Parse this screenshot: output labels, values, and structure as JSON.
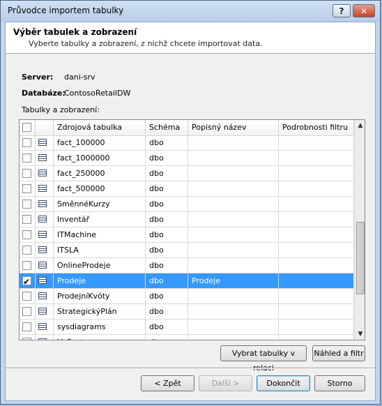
{
  "window": {
    "title": "Průvodce importem tabulky",
    "help_label": "?",
    "close_label": "✕"
  },
  "header": {
    "title": "Výběr tabulek a zobrazení",
    "description": "Vyberte tabulky a zobrazení, z nichž chcete importovat data."
  },
  "info": {
    "server_label": "Server:",
    "server_value": "dani-srv",
    "database_label": "Databáze:",
    "database_value": "ContosoRetailDW"
  },
  "grid": {
    "label": "Tabulky a zobrazení:",
    "columns": [
      "Zdrojová tabulka",
      "Schéma",
      "Popisný název",
      "Podrobnosti filtru"
    ],
    "rows": [
      {
        "checked": false,
        "name": "fact_100000",
        "schema": "dbo",
        "friendly": "",
        "filter": "",
        "selected": false
      },
      {
        "checked": false,
        "name": "fact_1000000",
        "schema": "dbo",
        "friendly": "",
        "filter": "",
        "selected": false
      },
      {
        "checked": false,
        "name": "fact_250000",
        "schema": "dbo",
        "friendly": "",
        "filter": "",
        "selected": false
      },
      {
        "checked": false,
        "name": "fact_500000",
        "schema": "dbo",
        "friendly": "",
        "filter": "",
        "selected": false
      },
      {
        "checked": false,
        "name": "SměnnéKurzy",
        "schema": "dbo",
        "friendly": "",
        "filter": "",
        "selected": false
      },
      {
        "checked": false,
        "name": "Inventář",
        "schema": "dbo",
        "friendly": "",
        "filter": "",
        "selected": false
      },
      {
        "checked": false,
        "name": "ITMachine",
        "schema": "dbo",
        "friendly": "",
        "filter": "",
        "selected": false
      },
      {
        "checked": false,
        "name": "ITSLA",
        "schema": "dbo",
        "friendly": "",
        "filter": "",
        "selected": false
      },
      {
        "checked": false,
        "name": "OnlineProdeje",
        "schema": "dbo",
        "friendly": "",
        "filter": "",
        "selected": false
      },
      {
        "checked": true,
        "name": "Prodeje",
        "schema": "dbo",
        "friendly": "Prodeje",
        "filter": "",
        "selected": true
      },
      {
        "checked": false,
        "name": "ProdejníKvóty",
        "schema": "dbo",
        "friendly": "",
        "filter": "",
        "selected": false
      },
      {
        "checked": false,
        "name": "StrategickýPlán",
        "schema": "dbo",
        "friendly": "",
        "filter": "",
        "selected": false
      },
      {
        "checked": false,
        "name": "sysdiagrams",
        "schema": "dbo",
        "friendly": "",
        "filter": "",
        "selected": false
      },
      {
        "checked": false,
        "name": "V_Customer",
        "schema": "dbo",
        "friendly": "",
        "filter": "",
        "selected": false
      }
    ]
  },
  "actions": {
    "select_related": "Vybrat tabulky v relaci",
    "preview_filter": "Náhled a filtr"
  },
  "footer": {
    "back": "< Zpět",
    "next": "Další >",
    "finish": "Dokončit",
    "cancel": "Storno"
  }
}
